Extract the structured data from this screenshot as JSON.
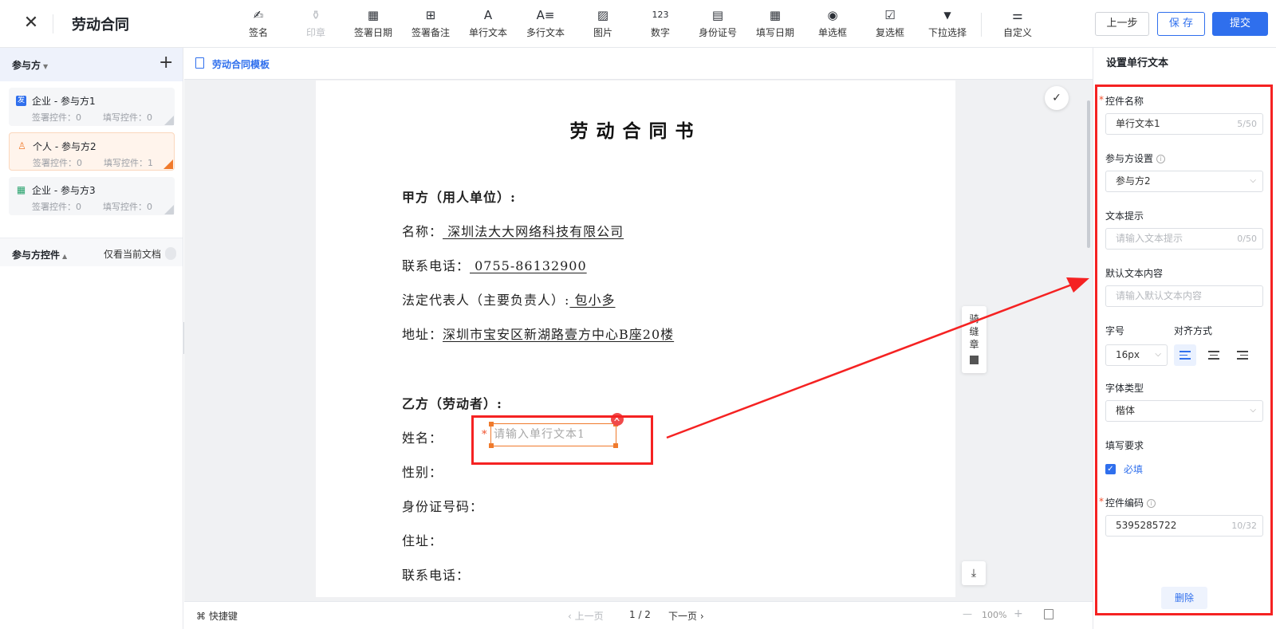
{
  "header": {
    "title": "劳动合同",
    "tools": [
      {
        "label": "签名",
        "icon": "✍",
        "disabled": false
      },
      {
        "label": "印章",
        "icon": "⚱",
        "disabled": true
      },
      {
        "label": "签署日期",
        "icon": "▦",
        "disabled": false
      },
      {
        "label": "签署备注",
        "icon": "⊞",
        "disabled": false
      },
      {
        "label": "单行文本",
        "icon": "A",
        "disabled": false
      },
      {
        "label": "多行文本",
        "icon": "A≡",
        "disabled": false
      },
      {
        "label": "图片",
        "icon": "▨",
        "disabled": false
      },
      {
        "label": "数字",
        "icon": "123",
        "disabled": false
      },
      {
        "label": "身份证号",
        "icon": "▤",
        "disabled": false
      },
      {
        "label": "填写日期",
        "icon": "▦",
        "disabled": false
      },
      {
        "label": "单选框",
        "icon": "◉",
        "disabled": false
      },
      {
        "label": "复选框",
        "icon": "☑",
        "disabled": false
      },
      {
        "label": "下拉选择",
        "icon": "▼",
        "disabled": false
      },
      {
        "label": "自定义",
        "icon": "⚌",
        "disabled": false
      }
    ],
    "prev_label": "上一步",
    "save_label": "保 存",
    "submit_label": "提交"
  },
  "sidebar": {
    "participants_title": "参与方",
    "parties": [
      {
        "name": "企业 - 参与方1",
        "sign": "签署控件：0",
        "fill": "填写控件：0",
        "badge": "发"
      },
      {
        "name": "个人 - 参与方2",
        "sign": "签署控件：0",
        "fill": "填写控件：1",
        "badge": "♙"
      },
      {
        "name": "企业 - 参与方3",
        "sign": "签署控件：0",
        "fill": "填写控件：0",
        "badge": "▦"
      }
    ],
    "controls_title": "参与方控件",
    "only_current": "仅看当前文档"
  },
  "document": {
    "tab_label": "劳动合同模板",
    "heading": "劳动合同书",
    "party_a_title": "甲方（用人单位）:",
    "name_label": "名称：",
    "name_value": "  深圳法大大网络科技有限公司  ",
    "phone_label": "联系电话：",
    "phone_value": "  0755-86132900  ",
    "rep_label": "法定代表人（主要负责人）:",
    "rep_value": "  包小多  ",
    "addr_label": "地址：",
    "addr_value": "深圳市宝安区新湖路壹方中心B座20楼",
    "party_b_title": "乙方（劳动者）:",
    "b_name": "姓名：",
    "b_gender": "性别：",
    "b_id": "身份证号码：",
    "b_addr": "住址：",
    "b_phone": "联系电话：",
    "field_placeholder": "请输入单行文本1",
    "seal_label": "骑缝章"
  },
  "footer": {
    "shortcut": "⌘ 快捷键",
    "prev_page": "‹ 上一页",
    "page": "1 / 2",
    "next_page": "下一页 ›",
    "zoom": "100%"
  },
  "panel": {
    "title": "设置单行文本",
    "name_label": "控件名称",
    "name_value": "单行文本1",
    "name_count": "5/50",
    "party_label": "参与方设置",
    "party_value": "参与方2",
    "hint_label": "文本提示",
    "hint_placeholder": "请输入文本提示",
    "hint_count": "0/50",
    "default_label": "默认文本内容",
    "default_placeholder": "请输入默认文本内容",
    "size_label": "字号",
    "size_value": "16px",
    "align_label": "对齐方式",
    "font_label": "字体类型",
    "font_value": "楷体",
    "req_label": "填写要求",
    "required_text": "必填",
    "code_label": "控件编码",
    "code_value": "5395285722",
    "code_count": "10/32",
    "delete_label": "删除"
  },
  "colors": {
    "accent": "#2f6fed",
    "annotation": "#f52222",
    "active_party": "#f07a2c"
  }
}
